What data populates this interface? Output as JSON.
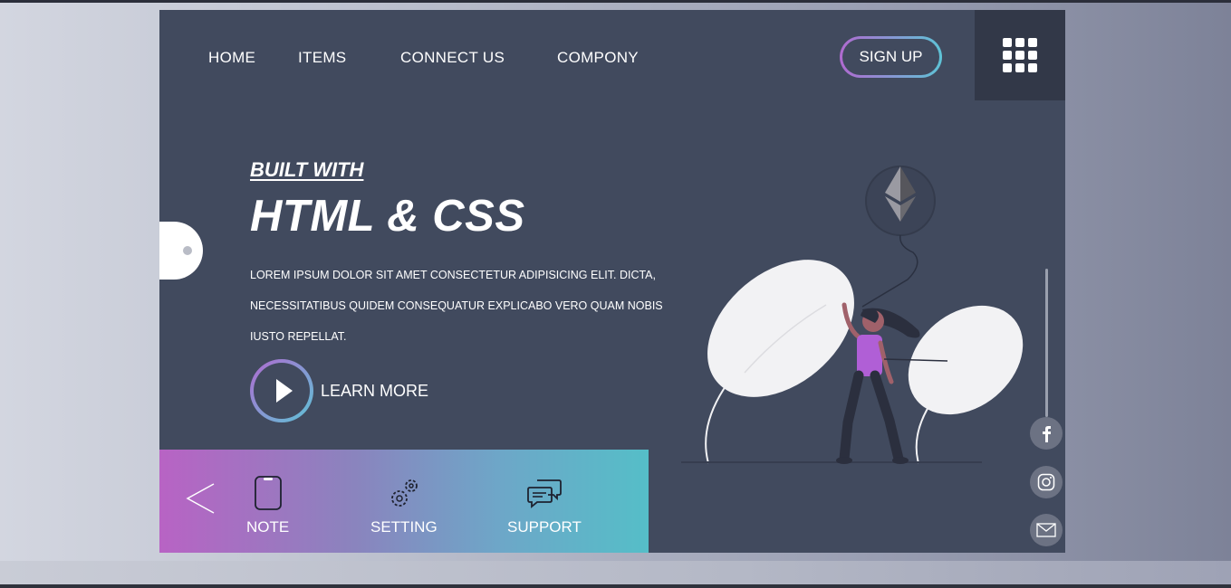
{
  "nav": {
    "items": [
      {
        "label": "HOME"
      },
      {
        "label": "ITEMS"
      },
      {
        "label": "CONNECT US"
      },
      {
        "label": "COMPONY"
      }
    ],
    "signup_label": "SIGN UP",
    "menu_icon": "grid-icon"
  },
  "hero": {
    "kicker": "BUILT WITH",
    "title": "HTML & CSS",
    "lines": [
      "LOREM IPSUM DOLOR SIT AMET CONSECTETUR ADIPISICING ELIT. DICTA,",
      "NECESSITATIBUS QUIDEM CONSEQUATUR EXPLICABO VERO QUAM NOBIS",
      "IUSTO REPELLAT."
    ],
    "cta_label": "LEARN MORE"
  },
  "panel": {
    "items": [
      {
        "label": "NOTE",
        "icon": "phone-icon"
      },
      {
        "label": "SETTING",
        "icon": "gears-icon"
      },
      {
        "label": "SUPPORT",
        "icon": "chat-bubbles-icon"
      }
    ]
  },
  "social": [
    {
      "icon": "facebook-icon"
    },
    {
      "icon": "instagram-icon"
    },
    {
      "icon": "mail-icon"
    }
  ],
  "colors": {
    "card_bg": "#414a5e",
    "gradient_start": "#b863c4",
    "gradient_end": "#55bec8",
    "figure_shirt": "#b05fd6"
  }
}
